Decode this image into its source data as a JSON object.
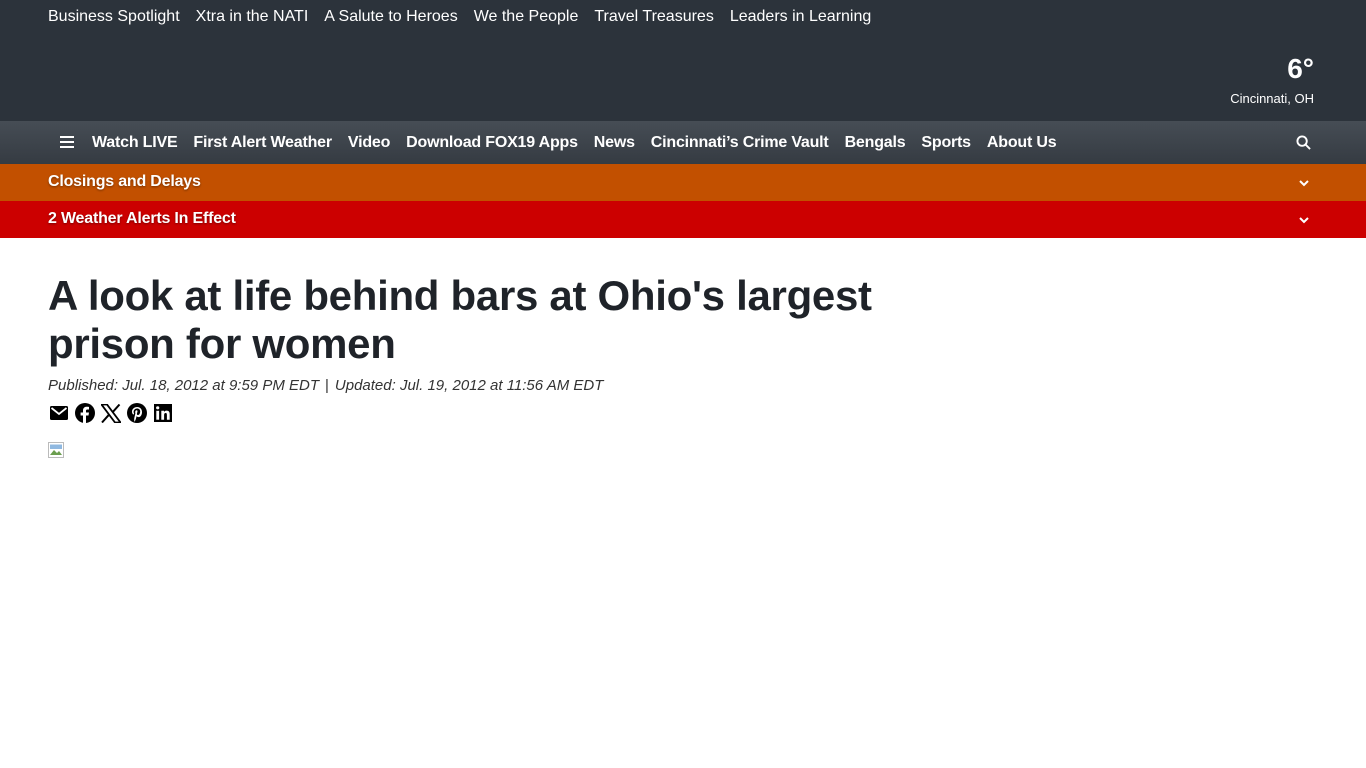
{
  "top_links": [
    "Business Spotlight",
    "Xtra in the NATI",
    "A Salute to Heroes",
    "We the People",
    "Travel Treasures",
    "Leaders in Learning"
  ],
  "weather": {
    "temperature": "6°",
    "location": "Cincinnati, OH"
  },
  "main_nav": {
    "menu_icon": "hamburger-icon",
    "items": [
      "Watch LIVE",
      "First Alert Weather",
      "Video",
      "Download FOX19 Apps",
      "News",
      "Cincinnati’s Crime Vault",
      "Bengals",
      "Sports",
      "About Us"
    ],
    "search_icon": "search-icon"
  },
  "banners": {
    "closings": "Closings and Delays",
    "alerts": "2 Weather Alerts In Effect"
  },
  "article": {
    "headline": "A look at life behind bars at Ohio's largest prison for women",
    "published": "Published: Jul. 18, 2012 at 9:59 PM EDT",
    "separator": "|",
    "updated": "Updated: Jul. 19, 2012 at 11:56 AM EDT",
    "share_icons": [
      "email-icon",
      "facebook-icon",
      "x-icon",
      "pinterest-icon",
      "linkedin-icon"
    ]
  },
  "colors": {
    "header_bg": "#2c333b",
    "closings_bg": "#c25000",
    "alerts_bg": "#cc0000"
  }
}
